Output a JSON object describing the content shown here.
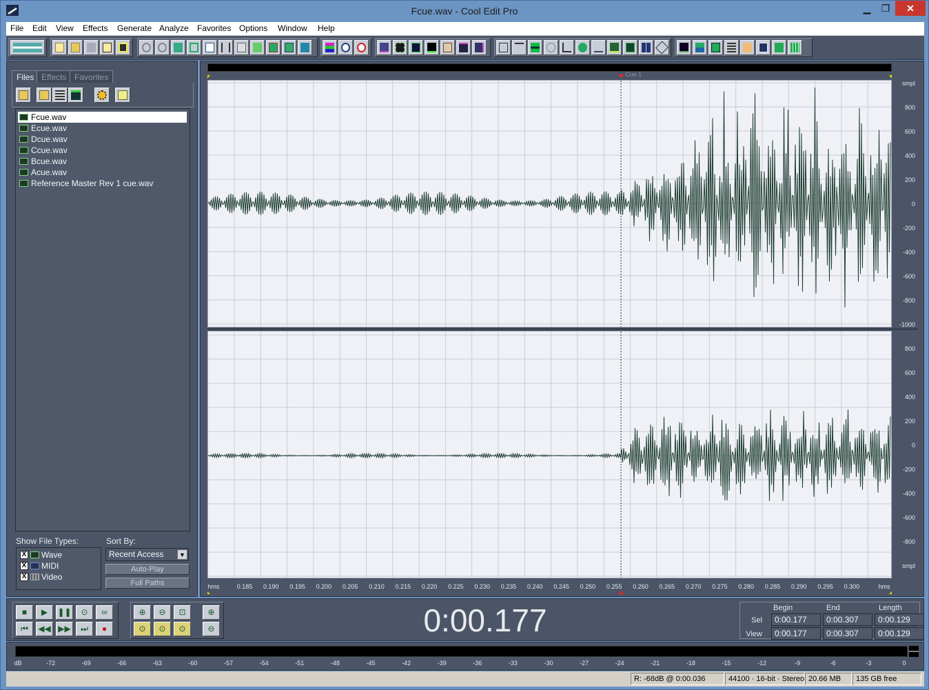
{
  "window": {
    "title": "Fcue.wav - Cool Edit Pro",
    "minimize": "▁",
    "maximize": "❐",
    "close": "✕"
  },
  "menu": [
    "File",
    "Edit",
    "View",
    "Effects",
    "Generate",
    "Analyze",
    "Favorites",
    "Options",
    "Window",
    "Help"
  ],
  "organizer": {
    "tabs": [
      "Files",
      "Effects",
      "Favorites"
    ],
    "files": [
      "Fcue.wav",
      "Ecue.wav",
      "Dcue.wav",
      "Ccue.wav",
      "Bcue.wav",
      "Acue.wav",
      "Reference Master Rev 1 cue.wav"
    ],
    "selected_index": 0,
    "show_types_label": "Show File Types:",
    "types": [
      {
        "label": "Wave",
        "checked": "X"
      },
      {
        "label": "MIDI",
        "checked": "X"
      },
      {
        "label": "Video",
        "checked": "X"
      }
    ],
    "sort_label": "Sort By:",
    "sort_value": "Recent Access",
    "autoplay_label": "Auto-Play",
    "fullpaths_label": "Full Paths"
  },
  "waveform": {
    "cue_label": "Cue 1",
    "amp_scale_top": [
      "smpl",
      "800",
      "600",
      "400",
      "200",
      "0",
      "-200",
      "-400",
      "-600",
      "-800",
      "-1000"
    ],
    "amp_scale_bottom": [
      "800",
      "600",
      "400",
      "200",
      "0",
      "-200",
      "-400",
      "-600",
      "-800",
      "smpl"
    ],
    "time_unit": "hms",
    "time_ticks": [
      "0.185",
      "0.190",
      "0.195",
      "0.200",
      "0.205",
      "0.210",
      "0.215",
      "0.220",
      "0.225",
      "0.230",
      "0.235",
      "0.240",
      "0.245",
      "0.250",
      "0.255",
      "0.260",
      "0.265",
      "0.270",
      "0.275",
      "0.280",
      "0.285",
      "0.290",
      "0.295",
      "0.300"
    ]
  },
  "transport": {
    "time": "0:00.177",
    "headers": [
      "Begin",
      "End",
      "Length"
    ],
    "sel_label": "Sel",
    "view_label": "View",
    "sel": [
      "0:00.177",
      "0:00.307",
      "0:00.129"
    ],
    "view": [
      "0:00.177",
      "0:00.307",
      "0:00.129"
    ]
  },
  "levels": {
    "ticks": [
      "dB",
      "-72",
      "-69",
      "-66",
      "-63",
      "-60",
      "-57",
      "-54",
      "-51",
      "-48",
      "-45",
      "-42",
      "-39",
      "-36",
      "-33",
      "-30",
      "-27",
      "-24",
      "-21",
      "-18",
      "-15",
      "-12",
      "-9",
      "-6",
      "-3",
      "0"
    ]
  },
  "status": [
    "R: -68dB @  0:00.036",
    "44100 · 16-bit · Stereo",
    "20.66 MB",
    "135 GB free"
  ],
  "colors": {
    "panel": "#4b5567",
    "wave_bg": "#eff1f6",
    "wave_line": "#1c3b2e",
    "grid": "#c9ccd4"
  }
}
